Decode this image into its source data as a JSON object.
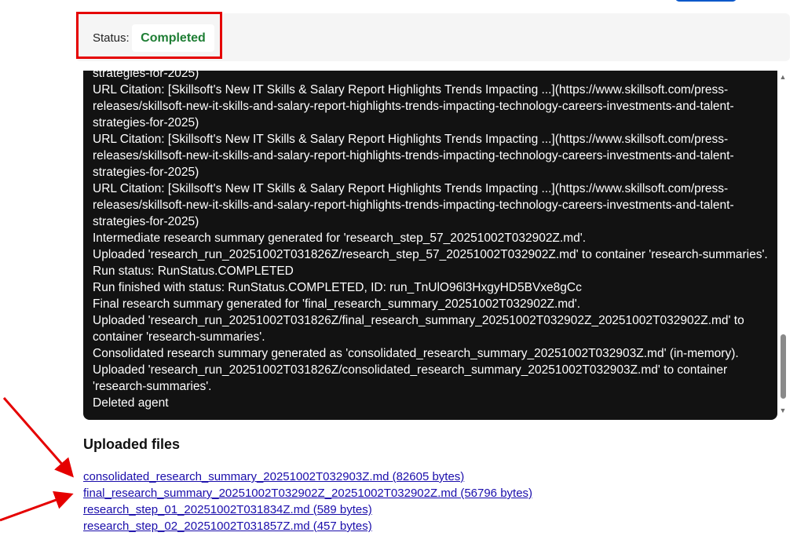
{
  "status": {
    "label": "Status:",
    "value": "Completed",
    "value_color": "#1e7e34"
  },
  "highlight_color": "#e50000",
  "log": {
    "lines": [
      "strategies-for-2025)",
      "URL Citation: [Skillsoft's New IT Skills & Salary Report Highlights Trends Impacting ...](https://www.skillsoft.com/press-",
      "releases/skillsoft-new-it-skills-and-salary-report-highlights-trends-impacting-technology-careers-investments-and-talent-",
      "strategies-for-2025)",
      "URL Citation: [Skillsoft's New IT Skills & Salary Report Highlights Trends Impacting ...](https://www.skillsoft.com/press-",
      "releases/skillsoft-new-it-skills-and-salary-report-highlights-trends-impacting-technology-careers-investments-and-talent-",
      "strategies-for-2025)",
      "URL Citation: [Skillsoft's New IT Skills & Salary Report Highlights Trends Impacting ...](https://www.skillsoft.com/press-",
      "releases/skillsoft-new-it-skills-and-salary-report-highlights-trends-impacting-technology-careers-investments-and-talent-",
      "strategies-for-2025)",
      "Intermediate research summary generated for 'research_step_57_20251002T032902Z.md'.",
      "Uploaded 'research_run_20251002T031826Z/research_step_57_20251002T032902Z.md' to container 'research-summaries'.",
      "Run status: RunStatus.COMPLETED",
      "Run finished with status: RunStatus.COMPLETED, ID: run_TnUlO96l3HxgyHD5BVxe8gCc",
      "Final research summary generated for 'final_research_summary_20251002T032902Z.md'.",
      "Uploaded 'research_run_20251002T031826Z/final_research_summary_20251002T032902Z_20251002T032902Z.md' to",
      "container 'research-summaries'.",
      "Consolidated research summary generated as 'consolidated_research_summary_20251002T032903Z.md' (in-memory).",
      "Uploaded 'research_run_20251002T031826Z/consolidated_research_summary_20251002T032903Z.md' to container",
      "'research-summaries'.",
      "Deleted agent"
    ]
  },
  "uploaded": {
    "heading": "Uploaded files",
    "files": [
      "consolidated_research_summary_20251002T032903Z.md (82605 bytes)",
      "final_research_summary_20251002T032902Z_20251002T032902Z.md (56796 bytes)",
      "research_step_01_20251002T031834Z.md (589 bytes)",
      "research_step_02_20251002T031857Z.md (457 bytes)"
    ]
  },
  "icons": {
    "scroll_up": "▲",
    "scroll_down": "▼"
  }
}
